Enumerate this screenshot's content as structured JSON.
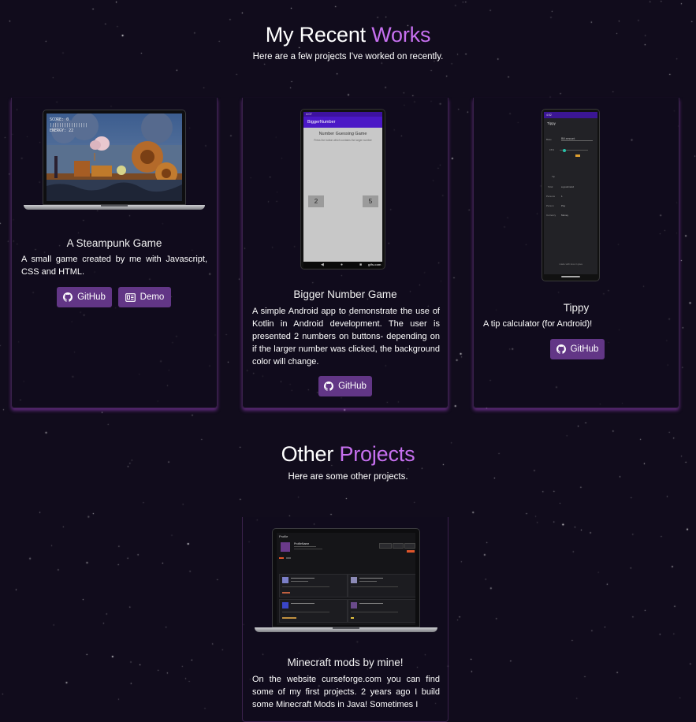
{
  "recent": {
    "heading_plain": "My Recent ",
    "heading_accent": "Works",
    "subtitle": "Here are a few projects I've worked on recently."
  },
  "projects": [
    {
      "title": "A Steampunk Game",
      "description": "A small game created by me with Javascript, CSS and HTML.",
      "buttons": [
        {
          "label": "GitHub",
          "icon": "github-icon"
        },
        {
          "label": "Demo",
          "icon": "demo-icon"
        }
      ],
      "screenshot": {
        "hud_lines": [
          "SCORE: 0",
          "||||||||||||||||",
          "ENERGY: 22"
        ]
      }
    },
    {
      "title": "Bigger Number Game",
      "description": "A simple Android app to demonstrate the use of Kotlin in Android development. The user is presented 2 numbers on buttons- depending on if the larger number was clicked, the background color will change.",
      "buttons": [
        {
          "label": "GitHub",
          "icon": "github-icon"
        }
      ],
      "screenshot": {
        "status_time": "4:07",
        "app_bar": "BiggerNumber",
        "game_title": "Number Guessing Game",
        "instructions": "Press the button which contains the larger number",
        "left_number": "2",
        "right_number": "5",
        "watermark": "gifs.com"
      }
    },
    {
      "title": "Tippy",
      "description": "A tip calculator (for Android)!",
      "buttons": [
        {
          "label": "GitHub",
          "icon": "github-icon"
        }
      ],
      "screenshot": {
        "status_time": "4:52",
        "app_bar": "Tippy",
        "rows": [
          {
            "label": "Base",
            "value": "Bill amount"
          },
          {
            "label": "15%",
            "value": ""
          },
          {
            "label": "Tip",
            "value": ""
          },
          {
            "label": "Total",
            "value": "a gourmand"
          },
          {
            "label": "Persons",
            "value": "1"
          },
          {
            "label": "Person",
            "value": "Pay"
          },
          {
            "label": "Currency",
            "value": "Money"
          }
        ],
        "footer": "made with love in java"
      }
    }
  ],
  "other": {
    "heading_plain": "Other ",
    "heading_accent": "Projects",
    "subtitle": "Here are some other projects."
  },
  "other_projects": [
    {
      "title": "Minecraft mods by mine!",
      "description": "On the website curseforge.com you can find some of my first projects. 2 years ago I build some Minecraft Mods in Java! Sometimes I",
      "screenshot": {
        "site_name": "Profile",
        "username": "ProfileName"
      }
    }
  ],
  "colors": {
    "background": "#110c1c",
    "accent": "#c770f0",
    "button": "#623686",
    "card_glow": "#9e41c9"
  }
}
